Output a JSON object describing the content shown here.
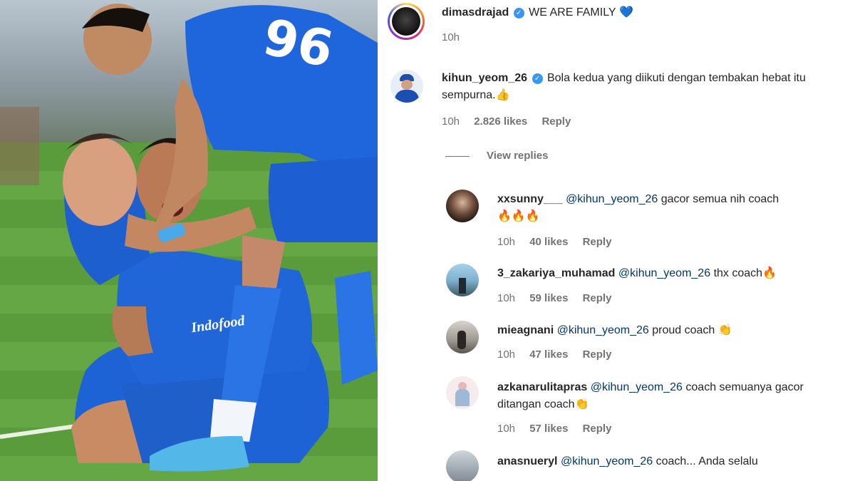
{
  "post": {
    "username": "dimasdrajad",
    "caption": "WE ARE FAMILY",
    "caption_emoji": "💙",
    "time": "10h"
  },
  "comment": {
    "username": "kihun_yeom_26",
    "text": "Bola kedua yang diikuti dengan tembakan hebat itu sempurna.",
    "emoji": "👍",
    "time": "10h",
    "likes": "2.826 likes",
    "reply_label": "Reply",
    "view_replies": "View replies"
  },
  "replies": [
    {
      "username": "xxsunny___",
      "mention": "@kihun_yeom_26",
      "text": "gacor semua nih coach",
      "emoji": "🔥🔥🔥",
      "time": "10h",
      "likes": "40 likes",
      "reply_label": "Reply"
    },
    {
      "username": "3_zakariya_muhamad",
      "mention": "@kihun_yeom_26",
      "text": "thx coach",
      "emoji": "🔥",
      "time": "10h",
      "likes": "59 likes",
      "reply_label": "Reply"
    },
    {
      "username": "mieagnani",
      "mention": "@kihun_yeom_26",
      "text": "proud coach",
      "emoji": "👏",
      "time": "10h",
      "likes": "47 likes",
      "reply_label": "Reply"
    },
    {
      "username": "azkanarulitapras",
      "mention": "@kihun_yeom_26",
      "text": "coach semuanya gacor ditangan coach",
      "emoji": "👏",
      "time": "10h",
      "likes": "57 likes",
      "reply_label": "Reply"
    },
    {
      "username": "anasnueryl",
      "mention": "@kihun_yeom_26",
      "text": "coach... Anda selalu",
      "emoji": "",
      "time": "",
      "likes": "",
      "reply_label": ""
    }
  ],
  "photo": {
    "jersey_number": "96",
    "sponsor_text": "Indofood"
  },
  "colors": {
    "verified": "#3897f0",
    "mention": "#00376b",
    "meta": "#737373",
    "kit_blue": "#1e63d6"
  }
}
